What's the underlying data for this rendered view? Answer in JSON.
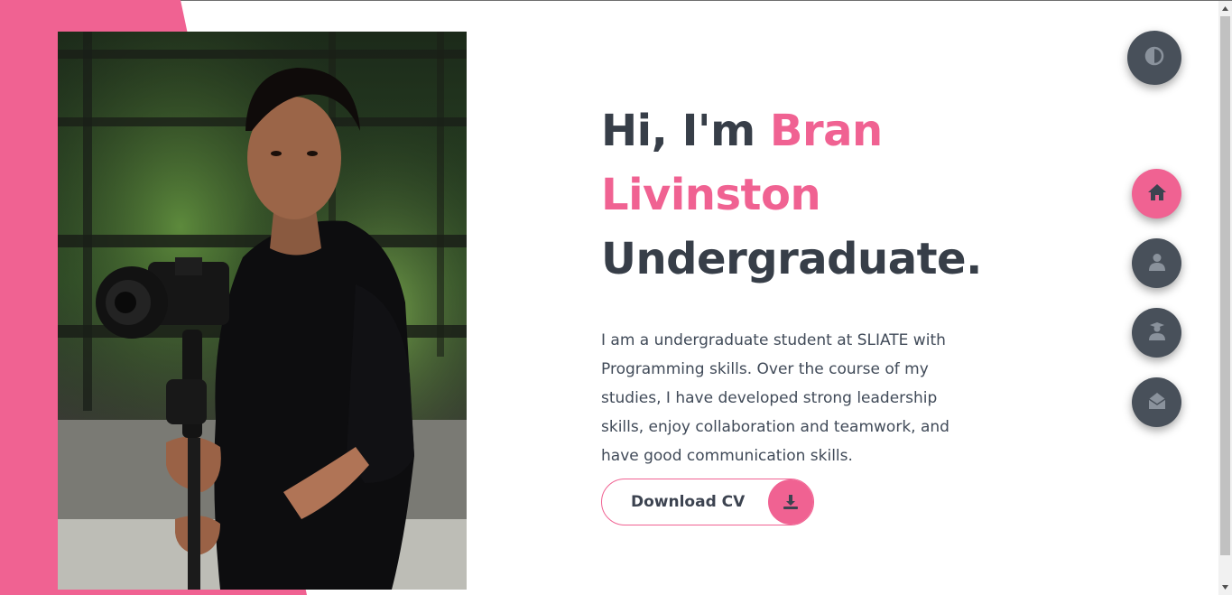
{
  "hero": {
    "greeting": "Hi, I'm ",
    "name_first": "Bran",
    "name_last": "Livinston",
    "role": "Undergraduate.",
    "description": "I am a undergraduate student at SLIATE with Programming skills. Over the course of my studies, I have developed strong leadership skills, enjoy collaboration and teamwork, and have good communication skills."
  },
  "cv_button": {
    "label": "Download CV",
    "icon": "download-icon"
  },
  "theme_toggle": {
    "icon": "contrast-icon"
  },
  "side_nav": [
    {
      "id": "home",
      "icon": "home-icon",
      "active": true
    },
    {
      "id": "about",
      "icon": "user-icon",
      "active": false
    },
    {
      "id": "education",
      "icon": "graduate-icon",
      "active": false
    },
    {
      "id": "contact",
      "icon": "envelope-open-icon",
      "active": false
    }
  ],
  "colors": {
    "accent": "#f06292",
    "dark": "#373e48",
    "fab": "#48505a"
  }
}
